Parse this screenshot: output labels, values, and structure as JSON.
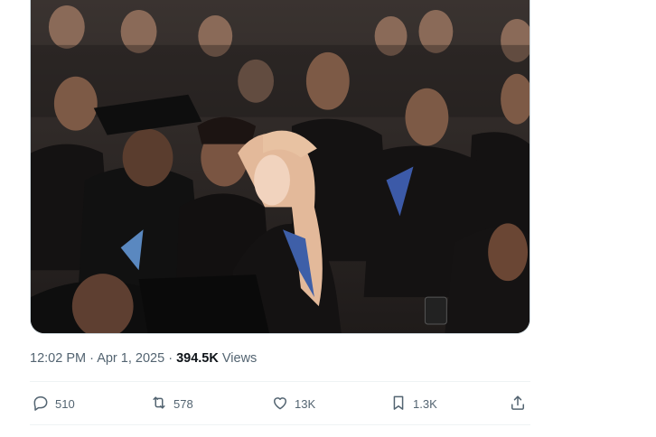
{
  "tweet": {
    "time": "12:02 PM",
    "separator": "·",
    "date": "Apr 1, 2025",
    "views_count": "394.5K",
    "views_label": "Views"
  },
  "actions": {
    "replies": "510",
    "reposts": "578",
    "likes": "13K",
    "bookmarks": "1.3K"
  },
  "colors": {
    "secondary_text": "#536471",
    "primary_text": "#0f1419",
    "divider": "#eff3f4"
  },
  "icons": [
    "reply-icon",
    "repost-icon",
    "like-icon",
    "bookmark-icon",
    "share-icon"
  ]
}
